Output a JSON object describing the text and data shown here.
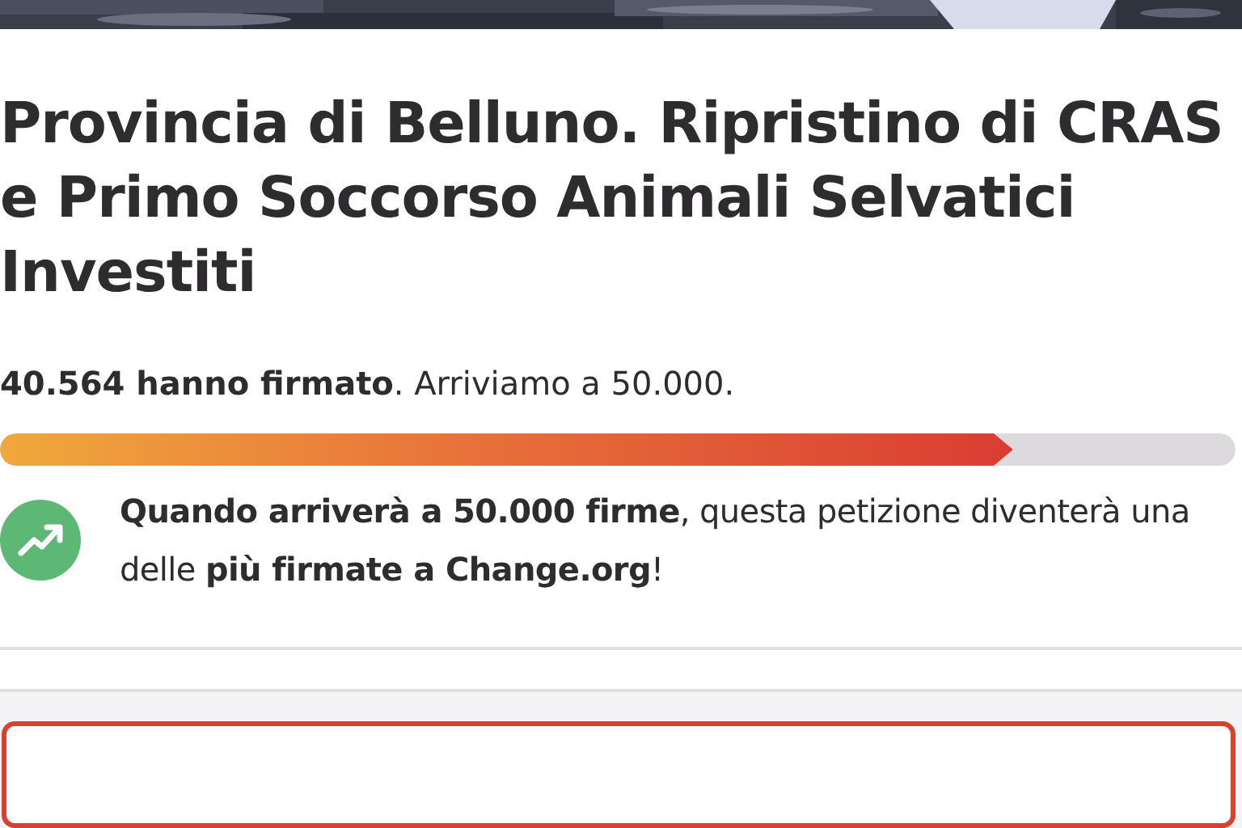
{
  "title": "Provincia di Belluno. Ripristino di CRAS e Primo Soccorso Animali Selvatici Investiti",
  "signatures": {
    "text": "**40.564 hanno firmato**. Arriviamo a 50.000."
  },
  "progress": {
    "level": 0.82
  },
  "milestone": {
    "text": "**Quando arriverà a 50.000 firme**, questa petizione diventerà una delle **più firmate a Change.org**!"
  },
  "share_button": {
    "kind": "outline"
  }
}
